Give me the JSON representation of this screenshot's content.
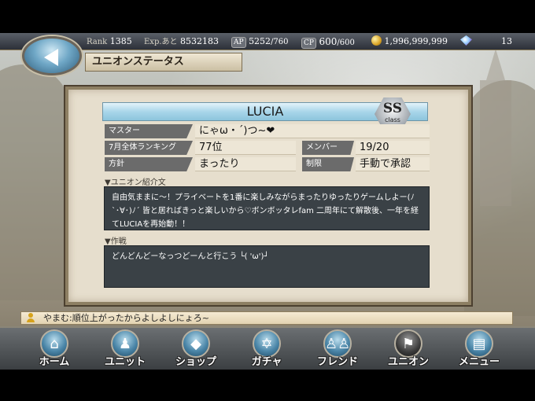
{
  "status": {
    "rank_label": "Rank",
    "rank": "1385",
    "exp_label": "Exp.あと",
    "exp": "8532183",
    "ap_label": "AP",
    "ap": "5252",
    "ap_max": "/760",
    "cp_label": "CP",
    "cp": "600",
    "cp_max": "/600",
    "gold": "1,996,999,999",
    "gems": "13"
  },
  "header": {
    "title": "ユニオンステータス"
  },
  "union": {
    "name": "LUCIA",
    "class_badge": "SS",
    "class_label": "class",
    "master_label": "マスター",
    "master": "にゃω・´)つ~❤",
    "ranking_label": "7月全体ランキング",
    "ranking": "77位",
    "members_label": "メンバー",
    "members": "19/20",
    "policy_label": "方針",
    "policy": "まったり",
    "restriction_label": "制限",
    "restriction": "手動で承認",
    "intro_heading": "▼ユニオン紹介文",
    "intro_text": "自由気ままに～！プライベートを1番に楽しみながらまったりゆったりゲームしよー(ﾉ`･∀･)ﾉ´ 皆と居ればきっと楽しいから♡ボンボッタレfam 二周年にて解散後、一年を経てLUCIAを再始動！！",
    "strategy_heading": "▼作戦",
    "strategy_text": "どんどんどーなっつどーんと行こう └( 'ω')┘"
  },
  "chat": {
    "message": "やまむ:順位上がったからよしよしにょろ~"
  },
  "nav": {
    "home": "ホーム",
    "unit": "ユニット",
    "shop": "ショップ",
    "gacha": "ガチャ",
    "friend": "フレンド",
    "union": "ユニオン",
    "menu": "メニュー"
  }
}
